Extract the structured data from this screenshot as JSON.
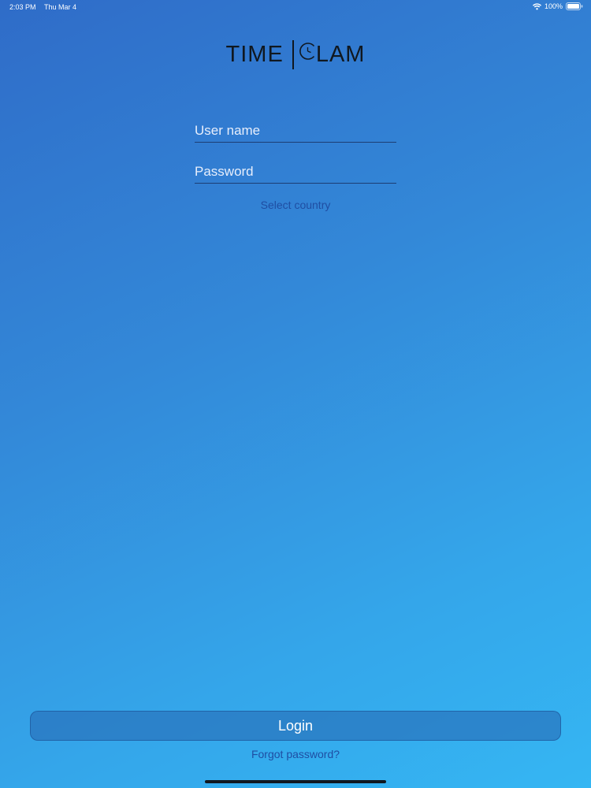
{
  "status_bar": {
    "time": "2:03 PM",
    "date": "Thu Mar 4",
    "battery": "100%"
  },
  "logo": {
    "left_text": "TIME",
    "right_text": "LAM"
  },
  "login_form": {
    "username_placeholder": "User name",
    "username_value": "",
    "password_placeholder": "Password",
    "password_value": "",
    "select_country_label": "Select country"
  },
  "actions": {
    "login_label": "Login",
    "forgot_password_label": "Forgot password?"
  },
  "colors": {
    "background_top": "#2f6cc8",
    "background_bottom": "#35b6f3",
    "link": "#1f4ea3",
    "logo": "#101820"
  },
  "icons": [
    "wifi-icon",
    "battery-icon",
    "clock-icon"
  ]
}
